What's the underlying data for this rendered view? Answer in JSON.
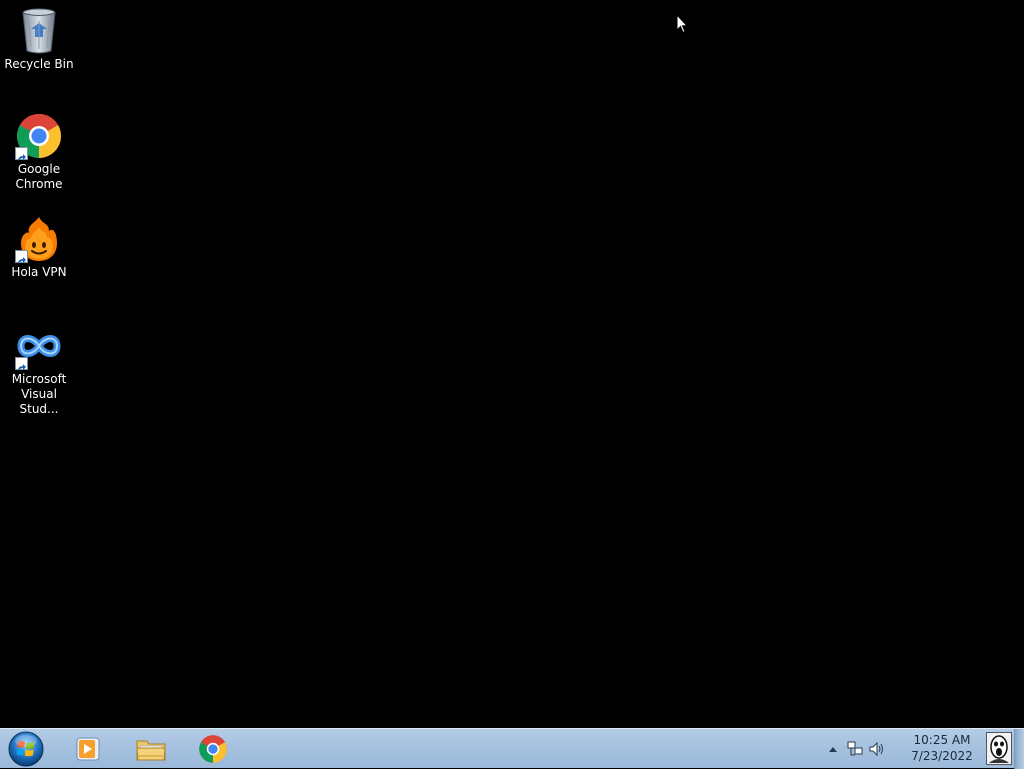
{
  "desktop": {
    "icons": [
      {
        "label": "Recycle Bin",
        "icon": "recycle-bin-icon",
        "shortcut": false
      },
      {
        "label": "Google Chrome",
        "icon": "chrome-icon",
        "shortcut": true
      },
      {
        "label": "Hola VPN",
        "icon": "hola-vpn-icon",
        "shortcut": true
      },
      {
        "label": "Microsoft Visual Stud...",
        "icon": "visual-studio-icon",
        "shortcut": true
      }
    ],
    "background_color": "#000000"
  },
  "taskbar": {
    "start_icon": "windows-start-orb-icon",
    "pinned": [
      {
        "name": "Windows Media Player",
        "icon": "media-player-icon"
      },
      {
        "name": "Windows Explorer",
        "icon": "folder-icon"
      },
      {
        "name": "Google Chrome",
        "icon": "chrome-icon"
      }
    ],
    "tray": {
      "show_hidden_icon": "chevron-up-icon",
      "network_icon": "network-icon",
      "volume_icon": "speaker-icon",
      "time": "10:25 AM",
      "date": "7/23/2022",
      "user_tile_icon": "user-tile-icon"
    },
    "colors": {
      "bar_top": "#b4cde6",
      "bar_bottom": "#9db9da",
      "clock_text": "#1b2a3c"
    }
  }
}
